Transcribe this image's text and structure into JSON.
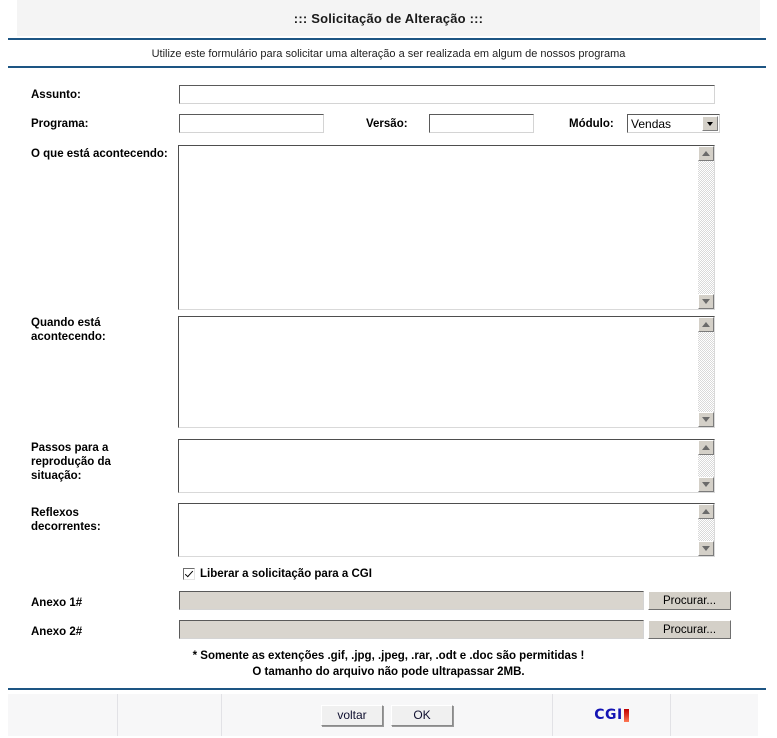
{
  "header": {
    "title": "::: Solicitação de Alteração :::",
    "subtitle": "Utilize este formulário para solicitar uma alteração a ser realizada em algum de nossos programa"
  },
  "form": {
    "assunto": {
      "label": "Assunto:",
      "value": "",
      "placeholder": ""
    },
    "programa": {
      "label": "Programa:",
      "value": "",
      "placeholder": ""
    },
    "versao": {
      "label": "Versão:",
      "value": "",
      "placeholder": ""
    },
    "modulo": {
      "label": "Módulo:",
      "selected": "Vendas",
      "options": [
        "Vendas"
      ]
    },
    "o_que_esta_acontecendo": {
      "label": "O que está acontecendo:",
      "value": ""
    },
    "quando_esta_acontecendo": {
      "label": "Quando está\nacontecendo:",
      "value": ""
    },
    "passos_reproducao": {
      "label": "Passos para a\nreprodução da\nsituação:",
      "value": ""
    },
    "reflexos_decorrentes": {
      "label": "Reflexos\ndecorrentes:",
      "value": ""
    },
    "liberar_checkbox": {
      "label": "Liberar a solicitação para a CGI",
      "checked": true
    },
    "anexo1": {
      "label": "Anexo 1#",
      "value": "",
      "button": "Procurar..."
    },
    "anexo2": {
      "label": "Anexo 2#",
      "value": "",
      "button": "Procurar..."
    }
  },
  "notes": {
    "line1": "* Somente as extenções .gif, .jpg, .jpeg, .rar, .odt e .doc são permitidas !",
    "line2": "O tamanho do arquivo não pode ultrapassar 2MB."
  },
  "footer": {
    "back_label": "voltar",
    "ok_label": "OK",
    "logo_text": "CGI"
  },
  "colors": {
    "rule": "#1d5583",
    "header_band": "#f4f4f4",
    "logo_blue": "#1414b4",
    "logo_red": "#c00000",
    "button_face": "#d4d0c8",
    "file_field": "#d9d5ce"
  }
}
